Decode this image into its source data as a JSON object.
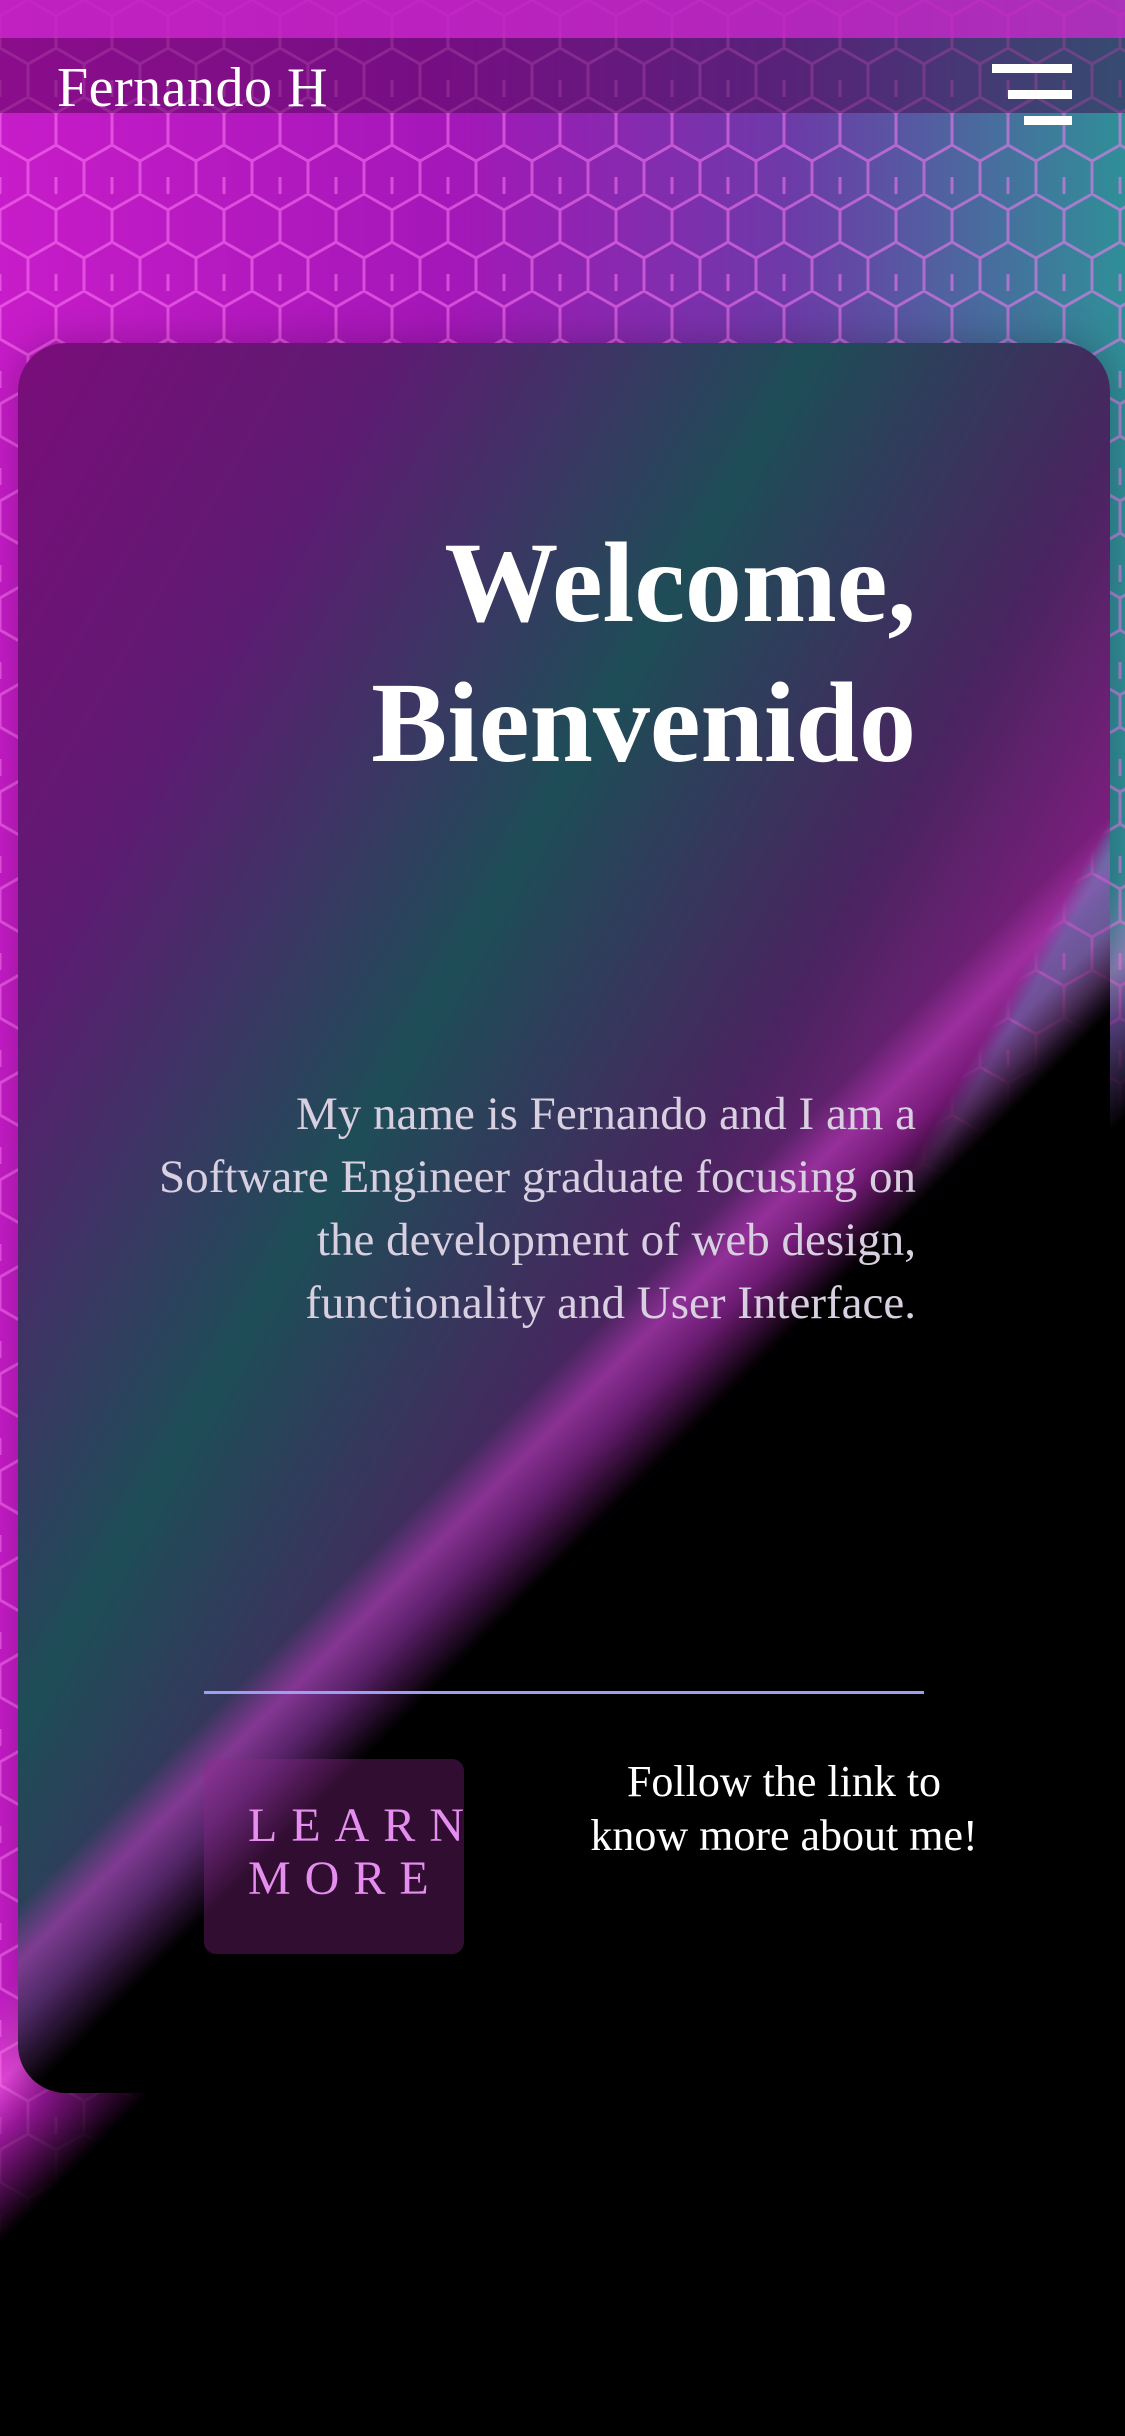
{
  "header": {
    "brand": "Fernando H",
    "menu_icon": "hamburger-menu-icon"
  },
  "hero": {
    "title_line1": "Welcome,",
    "title_line2": "Bienvenido",
    "intro": "My name is Fernando and I am a Software Engineer graduate focusing on the development of web design, functionality and User Interface."
  },
  "cta": {
    "learn_line1": "LEARN",
    "learn_line2": "MORE",
    "follow_text": "Follow the link to know more about me!"
  },
  "colors": {
    "magenta": "#c71cc9",
    "teal": "#2f8f97",
    "divider": "#9c9ef0",
    "learn_text": "#e58ef0"
  }
}
